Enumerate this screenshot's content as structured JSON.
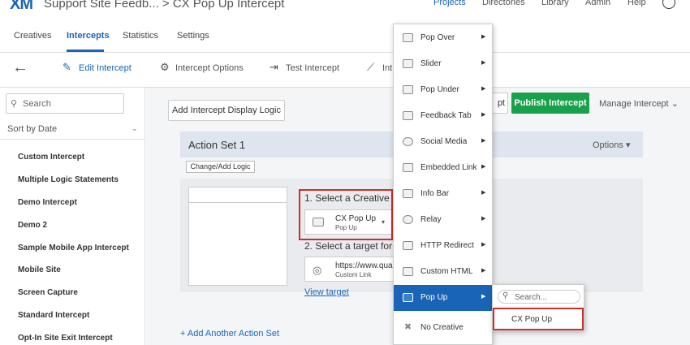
{
  "header": {
    "logo": "XM",
    "breadcrumb": "Support Site Feedb... > CX Pop Up Intercept",
    "nav": [
      "Projects",
      "Directories",
      "Library",
      "Admin",
      "Help"
    ]
  },
  "tabs": [
    "Creatives",
    "Intercepts",
    "Statistics",
    "Settings"
  ],
  "subnav": {
    "back": "←",
    "items": [
      "Edit Intercept",
      "Intercept Options",
      "Test Intercept",
      "Int"
    ]
  },
  "sidebar": {
    "search_placeholder": "Search",
    "sort_label": "Sort by Date",
    "items": [
      "Custom Intercept",
      "Multiple Logic Statements",
      "Demo Intercept",
      "Demo 2",
      "Sample Mobile App Intercept",
      "Mobile Site",
      "Screen Capture",
      "Standard Intercept",
      "Opt-In Site Exit Intercept"
    ]
  },
  "toolbar": {
    "add_logic": "Add Intercept Display Logic",
    "partial_button": "pt",
    "publish": "Publish Intercept",
    "manage": "Manage Intercept"
  },
  "action_set": {
    "title": "Action Set 1",
    "options": "Options",
    "change_logic": "Change/Add Logic",
    "step1": "1. Select a Creative to",
    "creative_name": "CX Pop Up",
    "creative_type": "Pop Up",
    "step2": "2. Select a target for y",
    "target_url": "https://www.qua",
    "target_type": "Custom Link",
    "view_target": "View target",
    "add_action_set": "+ Add Another Action Set"
  },
  "menu": {
    "items": [
      {
        "label": "Pop Over",
        "icon": "pop-over-icon",
        "arrow": true
      },
      {
        "label": "Slider",
        "icon": "slider-icon",
        "arrow": true
      },
      {
        "label": "Pop Under",
        "icon": "pop-under-icon",
        "arrow": true
      },
      {
        "label": "Feedback Tab",
        "icon": "feedback-tab-icon",
        "arrow": true
      },
      {
        "label": "Social Media",
        "icon": "social-media-icon",
        "arrow": true
      },
      {
        "label": "Embedded Link",
        "icon": "embedded-link-icon",
        "arrow": true
      },
      {
        "label": "Info Bar",
        "icon": "info-bar-icon",
        "arrow": true
      },
      {
        "label": "Relay",
        "icon": "relay-icon",
        "arrow": true
      },
      {
        "label": "HTTP Redirect",
        "icon": "http-redirect-icon",
        "arrow": true
      },
      {
        "label": "Custom HTML",
        "icon": "custom-html-icon",
        "arrow": true
      },
      {
        "label": "Pop Up",
        "icon": "pop-up-icon",
        "arrow": true,
        "highlighted": true
      },
      {
        "label": "No Creative",
        "icon": "no-creative-icon",
        "arrow": false
      }
    ],
    "submenu": {
      "search_placeholder": "Search...",
      "items": [
        "CX Pop Up"
      ]
    }
  },
  "colors": {
    "accent": "#1a64b7",
    "publish_green": "#19a04b",
    "highlight_red": "#c9302c"
  }
}
